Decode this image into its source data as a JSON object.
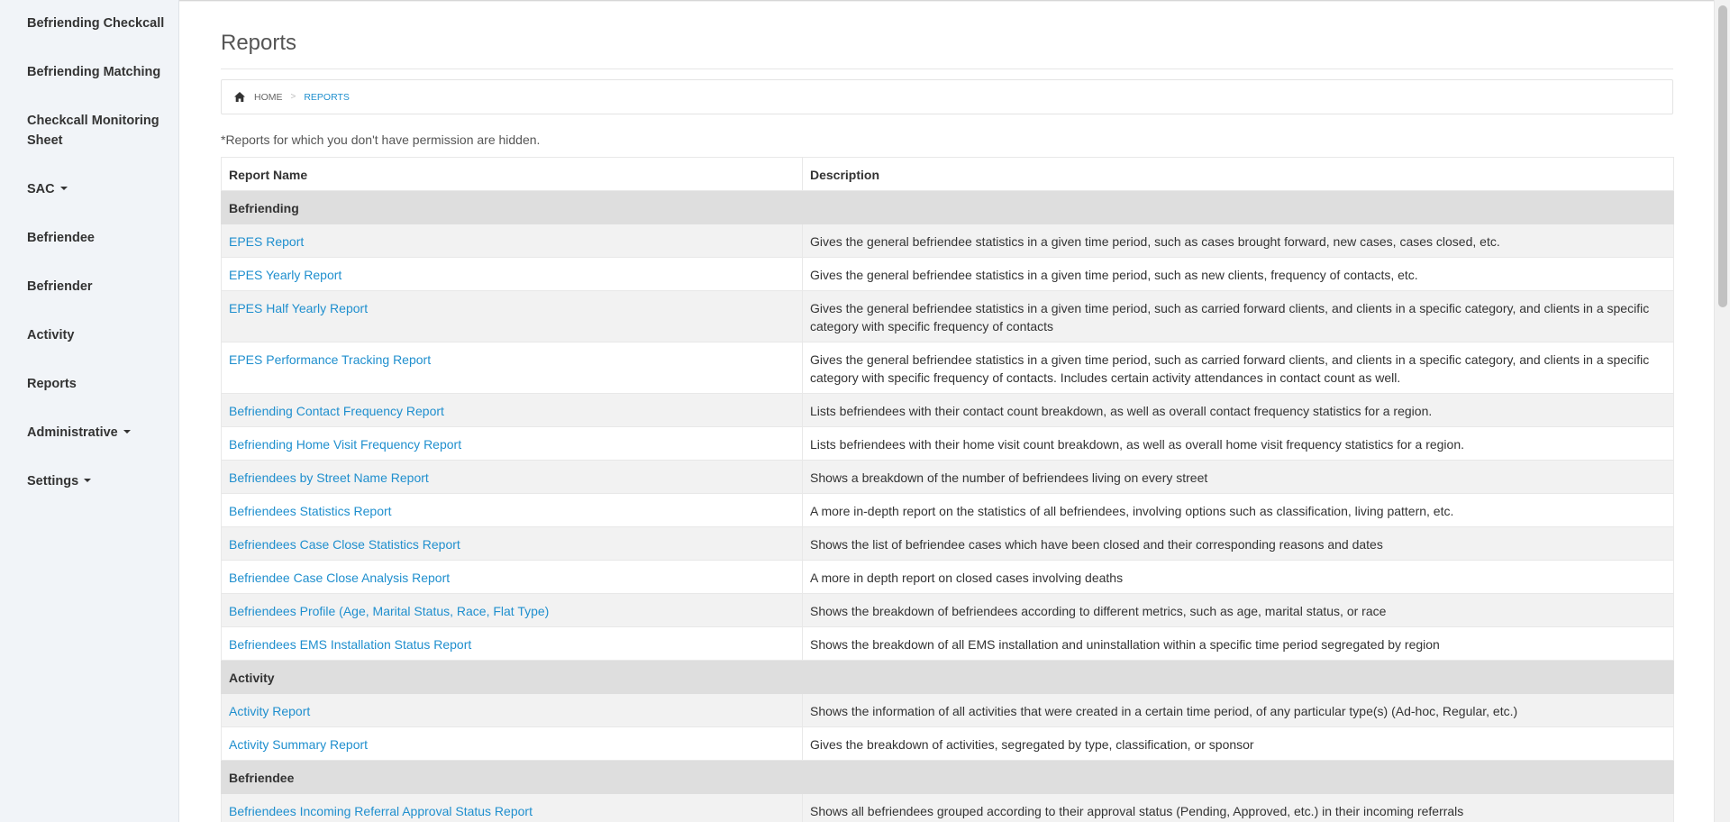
{
  "sidebar": {
    "items": [
      {
        "label": "Befriending Checkcall"
      },
      {
        "label": "Befriending Matching"
      },
      {
        "label": "Checkcall Monitoring Sheet"
      },
      {
        "label": "SAC"
      },
      {
        "label": "Befriendee"
      },
      {
        "label": "Befriender"
      },
      {
        "label": "Activity"
      },
      {
        "label": "Reports"
      },
      {
        "label": "Administrative"
      },
      {
        "label": "Settings"
      }
    ]
  },
  "page": {
    "title": "Reports",
    "note": "*Reports for which you don't have permission are hidden."
  },
  "breadcrumb": {
    "home": "HOME",
    "separator": ">",
    "current": "REPORTS"
  },
  "table": {
    "headers": [
      "Report Name",
      "Description"
    ],
    "groups": [
      {
        "name": "Befriending",
        "rows": [
          {
            "name": "EPES Report",
            "description": "Gives the general befriendee statistics in a given time period, such as cases brought forward, new cases, cases closed, etc."
          },
          {
            "name": "EPES Yearly Report",
            "description": "Gives the general befriendee statistics in a given time period, such as new clients, frequency of contacts, etc."
          },
          {
            "name": "EPES Half Yearly Report",
            "description": "Gives the general befriendee statistics in a given time period, such as carried forward clients, and clients in a specific category, and clients in a specific category with specific frequency of contacts"
          },
          {
            "name": "EPES Performance Tracking Report",
            "description": "Gives the general befriendee statistics in a given time period, such as carried forward clients, and clients in a specific category, and clients in a specific category with specific frequency of contacts. Includes certain activity attendances in contact count as well."
          },
          {
            "name": "Befriending Contact Frequency Report",
            "description": "Lists befriendees with their contact count breakdown, as well as overall contact frequency statistics for a region."
          },
          {
            "name": "Befriending Home Visit Frequency Report",
            "description": "Lists befriendees with their home visit count breakdown, as well as overall home visit frequency statistics for a region."
          },
          {
            "name": "Befriendees by Street Name Report",
            "description": "Shows a breakdown of the number of befriendees living on every street"
          },
          {
            "name": "Befriendees Statistics Report",
            "description": "A more in-depth report on the statistics of all befriendees, involving options such as classification, living pattern, etc."
          },
          {
            "name": "Befriendees Case Close Statistics Report",
            "description": "Shows the list of befriendee cases which have been closed and their corresponding reasons and dates"
          },
          {
            "name": "Befriendee Case Close Analysis Report",
            "description": "A more in depth report on closed cases involving deaths"
          },
          {
            "name": "Befriendees Profile (Age, Marital Status, Race, Flat Type)",
            "description": "Shows the breakdown of befriendees according to different metrics, such as age, marital status, or race"
          },
          {
            "name": "Befriendees EMS Installation Status Report",
            "description": "Shows the breakdown of all EMS installation and uninstallation within a specific time period segregated by region"
          }
        ]
      },
      {
        "name": "Activity",
        "rows": [
          {
            "name": "Activity Report",
            "description": "Shows the information of all activities that were created in a certain time period, of any particular type(s) (Ad-hoc, Regular, etc.)"
          },
          {
            "name": "Activity Summary Report",
            "description": "Gives the breakdown of activities, segregated by type, classification, or sponsor"
          }
        ]
      },
      {
        "name": "Befriendee",
        "rows": [
          {
            "name": "Befriendees Incoming Referral Approval Status Report",
            "description": "Shows all befriendees grouped according to their approval status (Pending, Approved, etc.) in their incoming referrals"
          }
        ]
      }
    ]
  }
}
